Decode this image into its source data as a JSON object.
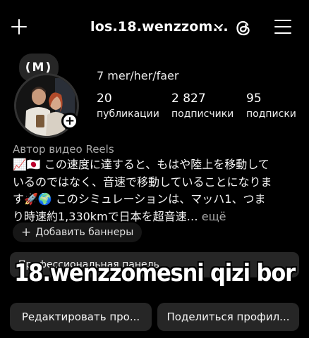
{
  "header": {
    "username": "los.18.wenzzom...",
    "icons": [
      "plus-icon",
      "chevron-down-icon",
      "threads-icon",
      "menu-icon"
    ]
  },
  "profile": {
    "note": "(M)",
    "pronouns": "7 mer/her/faer",
    "stats": [
      {
        "value": "20",
        "label": "публикации"
      },
      {
        "value": "2 827",
        "label": "подписчики"
      },
      {
        "value": "95",
        "label": "подписки"
      }
    ],
    "category": "Автор видео Reels",
    "bio_lines": [
      "📈🇯🇵 この速度に達すると、もはや陸上を移動して",
      "いるのではなく、音速で移動していることになりま",
      "す🚀🌍 このシミュレーションは、マッハ1、つま",
      "り時速約1,330kmで日本を超音速…"
    ],
    "bio_more": "ещё"
  },
  "buttons": {
    "add_banners": "Добавить баннеры",
    "dashboard": "Профессиональная панель",
    "edit_profile": "Редактировать про...",
    "share_profile": "Поделиться профил..."
  },
  "overlay_text": "18.wenzzomesni qizi bor",
  "colors": {
    "background": "#000000",
    "button_bg": "#262626",
    "secondary_text": "#a8a8a8"
  }
}
